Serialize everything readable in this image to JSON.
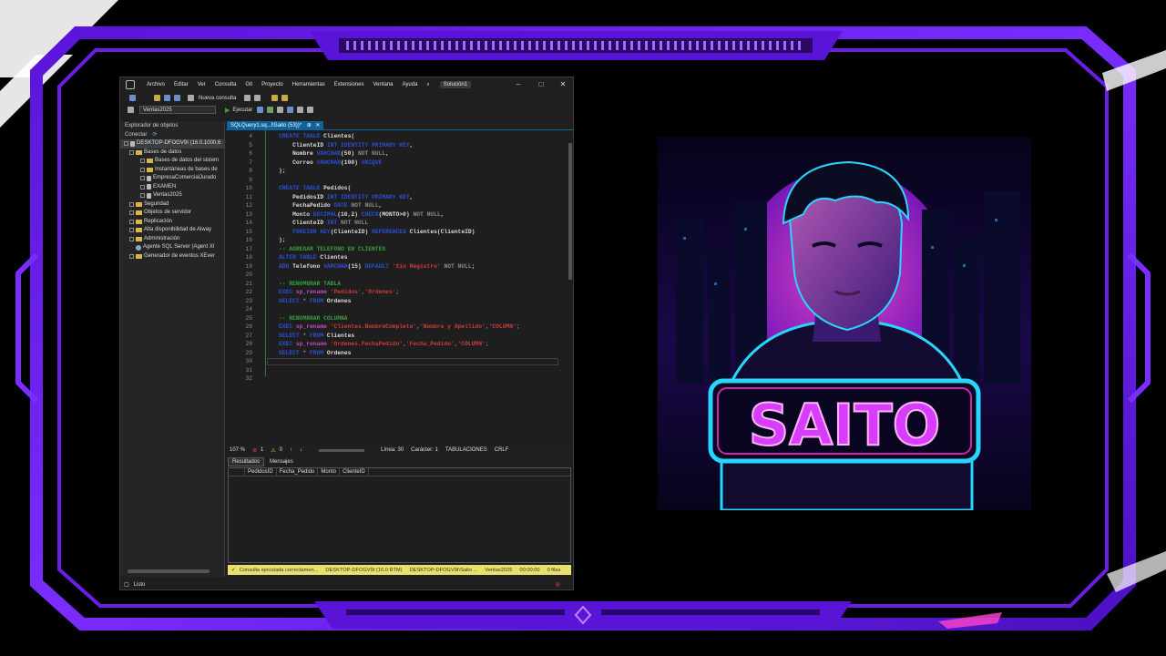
{
  "app": {
    "menu": [
      "Archivo",
      "Editar",
      "Ver",
      "Consulta",
      "Git",
      "Proyecto",
      "Herramientas",
      "Extensiones",
      "Ventana",
      "Ayuda"
    ],
    "solution_label": "Solución1",
    "window_controls": {
      "minimize": "–",
      "maximize": "□",
      "close": "✕"
    }
  },
  "toolbar": {
    "new_query_label": "Nueva consulta",
    "database_selected": "Ventas2025",
    "execute_label": "Ejecutar"
  },
  "object_explorer": {
    "title": "Explorador de objetos",
    "connect_label": "Conectar",
    "server": "DESKTOP-DFOGV9I (16.0.1000.6",
    "items": [
      {
        "label": "Bases de datos",
        "level": 1,
        "icon": "folder"
      },
      {
        "label": "Bases de datos del sistem",
        "level": 2,
        "icon": "folder"
      },
      {
        "label": "Instantáneas de bases de",
        "level": 2,
        "icon": "folder"
      },
      {
        "label": "EmpresaComercialJurado",
        "level": 2,
        "icon": "database"
      },
      {
        "label": "EXAMEN",
        "level": 2,
        "icon": "database"
      },
      {
        "label": "Ventas2025",
        "level": 2,
        "icon": "database"
      },
      {
        "label": "Seguridad",
        "level": 1,
        "icon": "folder"
      },
      {
        "label": "Objetos de servidor",
        "level": 1,
        "icon": "folder"
      },
      {
        "label": "Replicación",
        "level": 1,
        "icon": "folder"
      },
      {
        "label": "Alta disponibilidad de Alway",
        "level": 1,
        "icon": "folder"
      },
      {
        "label": "Administración",
        "level": 1,
        "icon": "folder"
      },
      {
        "label": "Agente SQL Server (Agent XI",
        "level": 1,
        "icon": "agent"
      },
      {
        "label": "Generador de eventos XEver",
        "level": 1,
        "icon": "folder"
      }
    ]
  },
  "editor": {
    "tab_label": "SQLQuery1.sq...l\\Saito (53))*",
    "lines": [
      {
        "n": "4",
        "tokens": [
          [
            "kw",
            "CREATE TABLE "
          ],
          [
            "",
            "Clientes("
          ]
        ]
      },
      {
        "n": "5",
        "tokens": [
          [
            "",
            "    ClienteID "
          ],
          [
            "ty",
            "INT IDENTITY PRIMARY KEY"
          ],
          [
            "",
            ","
          ]
        ]
      },
      {
        "n": "6",
        "tokens": [
          [
            "",
            "    Nombre "
          ],
          [
            "ty",
            "VARCHAR"
          ],
          [
            "",
            "(50) "
          ],
          [
            "gr",
            "NOT NULL"
          ],
          [
            "",
            ","
          ]
        ]
      },
      {
        "n": "7",
        "tokens": [
          [
            "",
            "    Correo "
          ],
          [
            "ty",
            "VARCHAR"
          ],
          [
            "",
            "(100) "
          ],
          [
            "ty",
            "UNIQUE"
          ]
        ]
      },
      {
        "n": "8",
        "tokens": [
          [
            "",
            ");"
          ]
        ]
      },
      {
        "n": "9",
        "tokens": []
      },
      {
        "n": "10",
        "tokens": [
          [
            "kw",
            "CREATE TABLE "
          ],
          [
            "",
            "Pedidos("
          ]
        ]
      },
      {
        "n": "11",
        "tokens": [
          [
            "",
            "    PedidosID "
          ],
          [
            "ty",
            "INT IDENTITY PRIMARY KEY"
          ],
          [
            "",
            ","
          ]
        ]
      },
      {
        "n": "12",
        "tokens": [
          [
            "",
            "    FechaPedido "
          ],
          [
            "ty",
            "DATE "
          ],
          [
            "gr",
            "NOT NULL"
          ],
          [
            "",
            ","
          ]
        ]
      },
      {
        "n": "13",
        "tokens": [
          [
            "",
            "    Monto "
          ],
          [
            "ty",
            "DECIMAL"
          ],
          [
            "",
            "(10,2) "
          ],
          [
            "ty",
            "CHECK"
          ],
          [
            "",
            "(MONTO>0) "
          ],
          [
            "gr",
            "NOT NULL"
          ],
          [
            "",
            ","
          ]
        ]
      },
      {
        "n": "14",
        "tokens": [
          [
            "",
            "    ClienteID "
          ],
          [
            "ty",
            "INT "
          ],
          [
            "gr",
            "NOT NULL"
          ]
        ]
      },
      {
        "n": "15",
        "tokens": [
          [
            "",
            "    "
          ],
          [
            "ty",
            "FOREIGN KEY"
          ],
          [
            "",
            "(ClienteID) "
          ],
          [
            "ty",
            "REFERENCES "
          ],
          [
            "",
            "Clientes(ClienteID)"
          ]
        ]
      },
      {
        "n": "16",
        "tokens": [
          [
            "",
            ");"
          ]
        ]
      },
      {
        "n": "17",
        "tokens": [
          [
            "cm",
            "-- AGREGAR TELEFONO EN CLIENTES"
          ]
        ]
      },
      {
        "n": "18",
        "tokens": [
          [
            "kw",
            "ALTER TABLE "
          ],
          [
            "",
            "Clientes"
          ]
        ]
      },
      {
        "n": "19",
        "tokens": [
          [
            "kw",
            "ADD "
          ],
          [
            "",
            "Telefono "
          ],
          [
            "ty",
            "VARCHAR"
          ],
          [
            "",
            "(15) "
          ],
          [
            "ty",
            "DEFAULT "
          ],
          [
            "str",
            "'Sin Registro'"
          ],
          [
            "gr",
            " NOT NULL"
          ],
          [
            "",
            ";"
          ]
        ]
      },
      {
        "n": "20",
        "tokens": []
      },
      {
        "n": "21",
        "tokens": [
          [
            "cm",
            "-- RENOMBRAR TABLA"
          ]
        ]
      },
      {
        "n": "22",
        "tokens": [
          [
            "kw",
            "EXEC "
          ],
          [
            "fn",
            "sp_rename "
          ],
          [
            "str",
            "'Pedidos'"
          ],
          [
            "gr",
            ","
          ],
          [
            "str",
            "'Ordenes'"
          ],
          [
            "gr",
            ";"
          ]
        ]
      },
      {
        "n": "23",
        "tokens": [
          [
            "kw",
            "SELECT "
          ],
          [
            "gr",
            "* "
          ],
          [
            "kw",
            "FROM "
          ],
          [
            "",
            "Ordenes"
          ]
        ]
      },
      {
        "n": "24",
        "tokens": []
      },
      {
        "n": "25",
        "tokens": [
          [
            "cm",
            "-- RENOMBRAR COLUMNA"
          ]
        ]
      },
      {
        "n": "26",
        "tokens": [
          [
            "kw",
            "EXEC "
          ],
          [
            "fn",
            "sp_rename "
          ],
          [
            "str",
            "'Clientes.NombreCompleto'"
          ],
          [
            "gr",
            ","
          ],
          [
            "str",
            "'Nombre y Apellido'"
          ],
          [
            "gr",
            ","
          ],
          [
            "str",
            "'COLUMN'"
          ],
          [
            "gr",
            ";"
          ]
        ]
      },
      {
        "n": "27",
        "tokens": [
          [
            "kw",
            "SELECT "
          ],
          [
            "gr",
            "* "
          ],
          [
            "kw",
            "FROM "
          ],
          [
            "",
            "Clientes"
          ]
        ]
      },
      {
        "n": "28",
        "tokens": [
          [
            "kw",
            "EXEC "
          ],
          [
            "fn",
            "sp_rename "
          ],
          [
            "str",
            "'Ordenes.FechaPedido'"
          ],
          [
            "gr",
            ","
          ],
          [
            "str",
            "'Fecha_Pedido'"
          ],
          [
            "gr",
            ","
          ],
          [
            "str",
            "'COLUMN'"
          ],
          [
            "gr",
            ";"
          ]
        ]
      },
      {
        "n": "29",
        "tokens": [
          [
            "kw",
            "SELECT "
          ],
          [
            "gr",
            "* "
          ],
          [
            "kw",
            "FROM "
          ],
          [
            "",
            "Ordenes"
          ]
        ]
      },
      {
        "n": "30",
        "tokens": []
      },
      {
        "n": "31",
        "tokens": []
      },
      {
        "n": "32",
        "tokens": []
      }
    ],
    "status": {
      "zoom": "107 %",
      "errors": "1",
      "warnings": "0",
      "line": "Línea: 30",
      "char": "Carácter: 1",
      "tabs": "TABULACIONES",
      "eol": "CRLF"
    }
  },
  "results": {
    "tabs": [
      "Resultados",
      "Mensajes"
    ],
    "columns": [
      "PedidosID",
      "Fecha_Pedido",
      "Monto",
      "ClienteID"
    ]
  },
  "query_status": {
    "message": "Consulta ejecutada correctamen...",
    "server": "DESKTOP-DFOGV9I (16.0 RTM)",
    "user": "DESKTOP-DFOGV9I\\Saito ...",
    "database": "Ventas2025",
    "time": "00:00:00",
    "rows": "0 filas"
  },
  "statusbar": {
    "text": "Listo"
  },
  "avatar": {
    "brand_text": "SAITO"
  },
  "colors": {
    "frame_purple": "#7b2cff",
    "neon_cyan": "#27d6ff",
    "neon_magenta": "#ff2fd0"
  }
}
